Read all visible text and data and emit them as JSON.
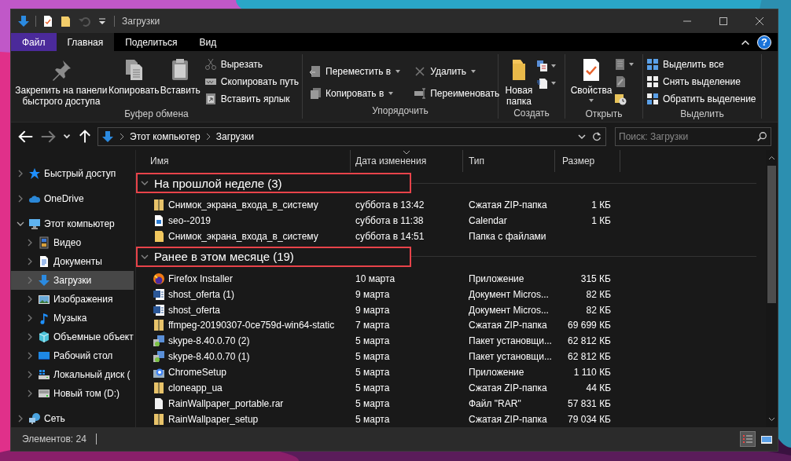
{
  "window": {
    "title": "Загрузки"
  },
  "ribbon_tabs": [
    {
      "label": "Файл",
      "kind": "file",
      "selected": false
    },
    {
      "label": "Главная",
      "kind": "tab",
      "selected": true
    },
    {
      "label": "Поделиться",
      "kind": "tab",
      "selected": false
    },
    {
      "label": "Вид",
      "kind": "tab",
      "selected": false
    }
  ],
  "help": "?",
  "ribbon": {
    "clipboard": {
      "label": "Буфер обмена",
      "pin": "Закрепить на панели быстрого доступа",
      "copy": "Копировать",
      "paste": "Вставить",
      "cut": "Вырезать",
      "copy_path": "Скопировать путь",
      "paste_shortcut": "Вставить ярлык"
    },
    "organize": {
      "label": "Упорядочить",
      "move_to": "Переместить в",
      "copy_to": "Копировать в",
      "delete": "Удалить",
      "rename": "Переименовать"
    },
    "new": {
      "label": "Создать",
      "new_folder": "Новая папка"
    },
    "open": {
      "label": "Открыть",
      "properties": "Свойства"
    },
    "select": {
      "label": "Выделить",
      "select_all": "Выделить все",
      "select_none": "Снять выделение",
      "invert": "Обратить выделение"
    }
  },
  "address": {
    "path": [
      "Этот компьютер",
      "Загрузки"
    ]
  },
  "search": {
    "placeholder": "Поиск: Загрузки"
  },
  "sidebar": {
    "items": [
      {
        "label": "Быстрый доступ",
        "kind": "star",
        "expanded": false,
        "selected": false
      },
      {
        "label": "OneDrive",
        "kind": "cloud",
        "expanded": false,
        "selected": false
      },
      {
        "label": "Этот компьютер",
        "kind": "pc",
        "expanded": true,
        "selected": false,
        "children": [
          {
            "label": "Видео",
            "kind": "video",
            "expanded": false,
            "selected": false
          },
          {
            "label": "Документы",
            "kind": "docs",
            "expanded": false,
            "selected": false
          },
          {
            "label": "Загрузки",
            "kind": "download",
            "expanded": false,
            "selected": true
          },
          {
            "label": "Изображения",
            "kind": "pictures",
            "expanded": false,
            "selected": false
          },
          {
            "label": "Музыка",
            "kind": "music",
            "expanded": false,
            "selected": false
          },
          {
            "label": "Объемные объект",
            "kind": "cube",
            "expanded": false,
            "selected": false
          },
          {
            "label": "Рабочий стол",
            "kind": "desktop",
            "expanded": false,
            "selected": false
          },
          {
            "label": "Локальный диск (",
            "kind": "sysdrive",
            "expanded": false,
            "selected": false
          },
          {
            "label": "Новый том (D:)",
            "kind": "drive",
            "expanded": false,
            "selected": false
          }
        ]
      },
      {
        "label": "Сеть",
        "kind": "network",
        "expanded": false,
        "selected": false
      }
    ]
  },
  "columns": [
    {
      "label": "Имя",
      "sorted": false
    },
    {
      "label": "Дата изменения",
      "sorted": true
    },
    {
      "label": "Тип",
      "sorted": false
    },
    {
      "label": "Размер",
      "sorted": false
    }
  ],
  "groups": [
    {
      "label": "На прошлой неделе (3)",
      "expanded": true,
      "highlighted": true,
      "files": [
        {
          "name": "Снимок_экрана_входа_в_систему",
          "date": "суббота в 13:42",
          "type": "Сжатая ZIP-папка",
          "size": "1 КБ",
          "kind": "zip"
        },
        {
          "name": "seo--2019",
          "date": "суббота в 11:38",
          "type": "Calendar",
          "size": "1 КБ",
          "kind": "calendar"
        },
        {
          "name": "Снимок_экрана_входа_в_систему",
          "date": "суббота в 14:51",
          "type": "Папка с файлами",
          "kind": "folder"
        }
      ]
    },
    {
      "label": "Ранее в этом месяце (19)",
      "expanded": true,
      "highlighted": true,
      "files": [
        {
          "name": "Firefox Installer",
          "date": "10 марта",
          "type": "Приложение",
          "size": "315 КБ",
          "kind": "browser"
        },
        {
          "name": "shost_oferta (1)",
          "date": "9 марта",
          "type": "Документ Micros...",
          "size": "82 КБ",
          "kind": "doc"
        },
        {
          "name": "shost_oferta",
          "date": "9 марта",
          "type": "Документ Micros...",
          "size": "82 КБ",
          "kind": "doc"
        },
        {
          "name": "ffmpeg-20190307-0ce759d-win64-static",
          "date": "7 марта",
          "type": "Сжатая ZIP-папка",
          "size": "69 699 КБ",
          "kind": "zip"
        },
        {
          "name": "skype-8.40.0.70 (2)",
          "date": "5 марта",
          "type": "Пакет установщи...",
          "size": "62 812 КБ",
          "kind": "installer"
        },
        {
          "name": "skype-8.40.0.70 (1)",
          "date": "5 марта",
          "type": "Пакет установщи...",
          "size": "62 812 КБ",
          "kind": "installer"
        },
        {
          "name": "ChromeSetup",
          "date": "5 марта",
          "type": "Приложение",
          "size": "1 110 КБ",
          "kind": "setup"
        },
        {
          "name": "cloneapp_ua",
          "date": "5 марта",
          "type": "Сжатая ZIP-папка",
          "size": "44 КБ",
          "kind": "zip"
        },
        {
          "name": "RainWallpaper_portable.rar",
          "date": "5 марта",
          "type": "Файл \"RAR\"",
          "size": "57 831 КБ",
          "kind": "file"
        },
        {
          "name": "RainWallpaper_setup",
          "date": "5 марта",
          "type": "Сжатая ZIP-папка",
          "size": "79 034 КБ",
          "kind": "zip"
        }
      ]
    }
  ],
  "status_bar": {
    "count": "Элементов: 24",
    "view_buttons": [
      {
        "kind": "details",
        "selected": true
      },
      {
        "kind": "tiles",
        "selected": false
      }
    ]
  }
}
